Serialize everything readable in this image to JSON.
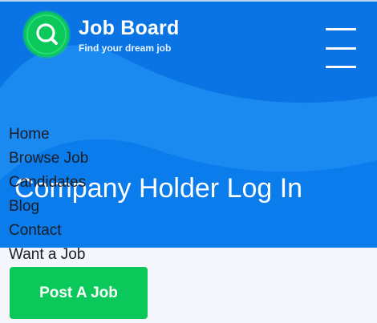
{
  "header": {
    "brand": "Job Board",
    "tagline": "Find your dream job",
    "logo_icon": "magnifier-icon",
    "menu_icon": "hamburger-menu-icon"
  },
  "hero": {
    "title": "Company Holder Log In"
  },
  "menu": {
    "items": [
      "Home",
      "Browse Job",
      "Candidates",
      "Blog",
      "Contact",
      "Want a Job"
    ]
  },
  "cta": {
    "label": "Post A Job"
  },
  "colors": {
    "hero_blue": "#0f7fe9",
    "accent_green": "#0ac95a",
    "page_background": "#f5f6fb",
    "menu_text": "#1b1d24"
  }
}
